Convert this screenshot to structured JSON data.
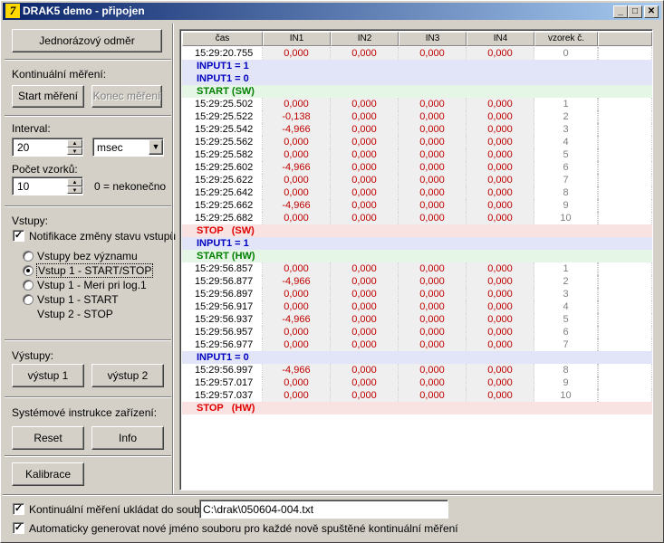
{
  "window": {
    "title": "DRAK5 demo - připojen",
    "icon": "app-icon"
  },
  "left": {
    "single_measure_button": "Jednorázový odměr",
    "continuous_label": "Kontinuální měření:",
    "start_button": "Start měření",
    "stop_button": "Konec měření",
    "interval_label": "Interval:",
    "interval_value": "20",
    "interval_unit": "msec",
    "sample_count_label": "Počet vzorků:",
    "sample_count_value": "10",
    "sample_count_hint": "0 = nekonečno",
    "inputs_label": "Vstupy:",
    "notify_checkbox": "Notifikace změny stavu vstupů",
    "notify_checked": true,
    "radio_options": [
      "Vstupy bez významu",
      "Vstup 1 - START/STOP",
      "Vstup 1 - Meri pri log.1",
      "Vstup 1 - START"
    ],
    "radio_extra_line": "Vstup 2 - STOP",
    "radio_selected": 1,
    "outputs_label": "Výstupy:",
    "output1_button": "výstup 1",
    "output2_button": "výstup 2",
    "system_label": "Systémové instrukce zařízení:",
    "reset_button": "Reset",
    "info_button": "Info",
    "calibration_button": "Kalibrace"
  },
  "table": {
    "columns": [
      "čas",
      "IN1",
      "IN2",
      "IN3",
      "IN4",
      "vzorek č."
    ],
    "rows": [
      {
        "type": "data",
        "time": "15:29:20.755",
        "in1": "0,000",
        "in2": "0,000",
        "in3": "0,000",
        "in4": "0,000",
        "n": "0"
      },
      {
        "type": "event",
        "color": "blue",
        "text": "INPUT1 = 1"
      },
      {
        "type": "event",
        "color": "blue",
        "text": "INPUT1 = 0"
      },
      {
        "type": "event",
        "color": "green",
        "text": "START (SW)"
      },
      {
        "type": "data",
        "time": "15:29:25.502",
        "in1": "0,000",
        "in2": "0,000",
        "in3": "0,000",
        "in4": "0,000",
        "n": "1"
      },
      {
        "type": "data",
        "time": "15:29:25.522",
        "in1": "-0,138",
        "in2": "0,000",
        "in3": "0,000",
        "in4": "0,000",
        "n": "2"
      },
      {
        "type": "data",
        "time": "15:29:25.542",
        "in1": "-4,966",
        "in2": "0,000",
        "in3": "0,000",
        "in4": "0,000",
        "n": "3"
      },
      {
        "type": "data",
        "time": "15:29:25.562",
        "in1": "0,000",
        "in2": "0,000",
        "in3": "0,000",
        "in4": "0,000",
        "n": "4"
      },
      {
        "type": "data",
        "time": "15:29:25.582",
        "in1": "0,000",
        "in2": "0,000",
        "in3": "0,000",
        "in4": "0,000",
        "n": "5"
      },
      {
        "type": "data",
        "time": "15:29:25.602",
        "in1": "-4,966",
        "in2": "0,000",
        "in3": "0,000",
        "in4": "0,000",
        "n": "6"
      },
      {
        "type": "data",
        "time": "15:29:25.622",
        "in1": "0,000",
        "in2": "0,000",
        "in3": "0,000",
        "in4": "0,000",
        "n": "7"
      },
      {
        "type": "data",
        "time": "15:29:25.642",
        "in1": "0,000",
        "in2": "0,000",
        "in3": "0,000",
        "in4": "0,000",
        "n": "8"
      },
      {
        "type": "data",
        "time": "15:29:25.662",
        "in1": "-4,966",
        "in2": "0,000",
        "in3": "0,000",
        "in4": "0,000",
        "n": "9"
      },
      {
        "type": "data",
        "time": "15:29:25.682",
        "in1": "0,000",
        "in2": "0,000",
        "in3": "0,000",
        "in4": "0,000",
        "n": "10"
      },
      {
        "type": "event",
        "color": "red",
        "text": "STOP   (SW)"
      },
      {
        "type": "event",
        "color": "blue",
        "text": "INPUT1 = 1"
      },
      {
        "type": "event",
        "color": "green",
        "text": "START (HW)"
      },
      {
        "type": "data",
        "time": "15:29:56.857",
        "in1": "0,000",
        "in2": "0,000",
        "in3": "0,000",
        "in4": "0,000",
        "n": "1"
      },
      {
        "type": "data",
        "time": "15:29:56.877",
        "in1": "-4,966",
        "in2": "0,000",
        "in3": "0,000",
        "in4": "0,000",
        "n": "2"
      },
      {
        "type": "data",
        "time": "15:29:56.897",
        "in1": "0,000",
        "in2": "0,000",
        "in3": "0,000",
        "in4": "0,000",
        "n": "3"
      },
      {
        "type": "data",
        "time": "15:29:56.917",
        "in1": "0,000",
        "in2": "0,000",
        "in3": "0,000",
        "in4": "0,000",
        "n": "4"
      },
      {
        "type": "data",
        "time": "15:29:56.937",
        "in1": "-4,966",
        "in2": "0,000",
        "in3": "0,000",
        "in4": "0,000",
        "n": "5"
      },
      {
        "type": "data",
        "time": "15:29:56.957",
        "in1": "0,000",
        "in2": "0,000",
        "in3": "0,000",
        "in4": "0,000",
        "n": "6"
      },
      {
        "type": "data",
        "time": "15:29:56.977",
        "in1": "0,000",
        "in2": "0,000",
        "in3": "0,000",
        "in4": "0,000",
        "n": "7"
      },
      {
        "type": "event",
        "color": "blue",
        "text": "INPUT1 = 0"
      },
      {
        "type": "data",
        "time": "15:29:56.997",
        "in1": "-4,966",
        "in2": "0,000",
        "in3": "0,000",
        "in4": "0,000",
        "n": "8"
      },
      {
        "type": "data",
        "time": "15:29:57.017",
        "in1": "0,000",
        "in2": "0,000",
        "in3": "0,000",
        "in4": "0,000",
        "n": "9"
      },
      {
        "type": "data",
        "time": "15:29:57.037",
        "in1": "0,000",
        "in2": "0,000",
        "in3": "0,000",
        "in4": "0,000",
        "n": "10"
      },
      {
        "type": "event",
        "color": "red",
        "text": "STOP   (HW)"
      }
    ]
  },
  "bottom": {
    "save_checkbox": "Kontinuální měření ukládat do souboru:",
    "save_checked": true,
    "file_path": "C:\\drak\\050604-004.txt",
    "auto_name_checkbox": "Automaticky generovat nové jméno souboru pro každé nově spuštěné kontinuální měření",
    "auto_name_checked": true
  },
  "colors": {
    "title_gradient_start": "#0a246a",
    "title_gradient_end": "#a6caf0",
    "value_red": "#c00000",
    "event_blue_bg": "#e2e4f8",
    "event_green_bg": "#e6f6e6",
    "event_red_bg": "#f8e2e2"
  }
}
